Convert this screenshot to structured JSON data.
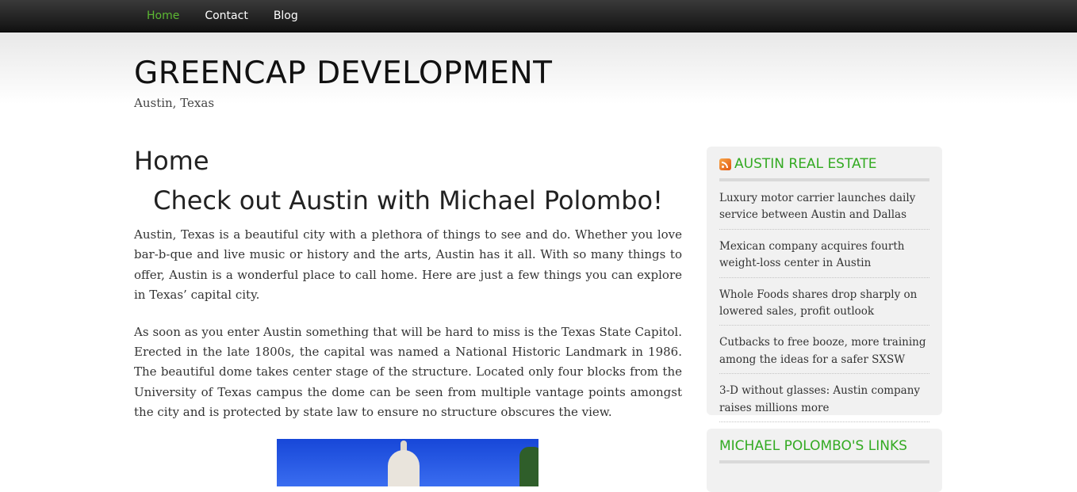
{
  "nav": {
    "items": [
      {
        "label": "Home",
        "active": true
      },
      {
        "label": "Contact",
        "active": false
      },
      {
        "label": "Blog",
        "active": false
      }
    ]
  },
  "site": {
    "title": "GREENCAP DEVELOPMENT",
    "tagline": "Austin, Texas"
  },
  "main": {
    "page_title": "Home",
    "heading": "Check out Austin with Michael Polombo!",
    "paragraphs": [
      "Austin, Texas is a beautiful city with a plethora of things to see and do.  Whether you love bar-b-que and live music or history and the arts, Austin has it all.  With so many things to offer, Austin is a wonderful place to call home.  Here are just a few things you can explore in Texas’ capital city.",
      "As soon as you enter Austin something that will be hard to miss is the Texas State Capitol.  Erected in the late 1800s, the capital was named a National Historic Landmark in 1986.  The beautiful dome takes center stage of the structure.  Located only four blocks from the University of Texas campus the dome can be seen from multiple vantage points amongst the city and is protected by state law to ensure no structure obscures the view."
    ]
  },
  "sidebar": {
    "rss_title": "AUSTIN REAL ESTATE",
    "rss_items": [
      "Luxury motor carrier launches daily service between Austin and Dallas",
      "Mexican company acquires fourth weight-loss center in Austin",
      "Whole Foods shares drop sharply on lowered sales, profit outlook",
      "Cutbacks to free booze, more training among the ideas for a safer SXSW",
      "3-D without glasses: Austin company raises millions more"
    ],
    "links_title": "MICHAEL POLOMBO'S LINKS"
  },
  "colors": {
    "accent_green": "#33aa22",
    "nav_active": "#5cb833"
  }
}
